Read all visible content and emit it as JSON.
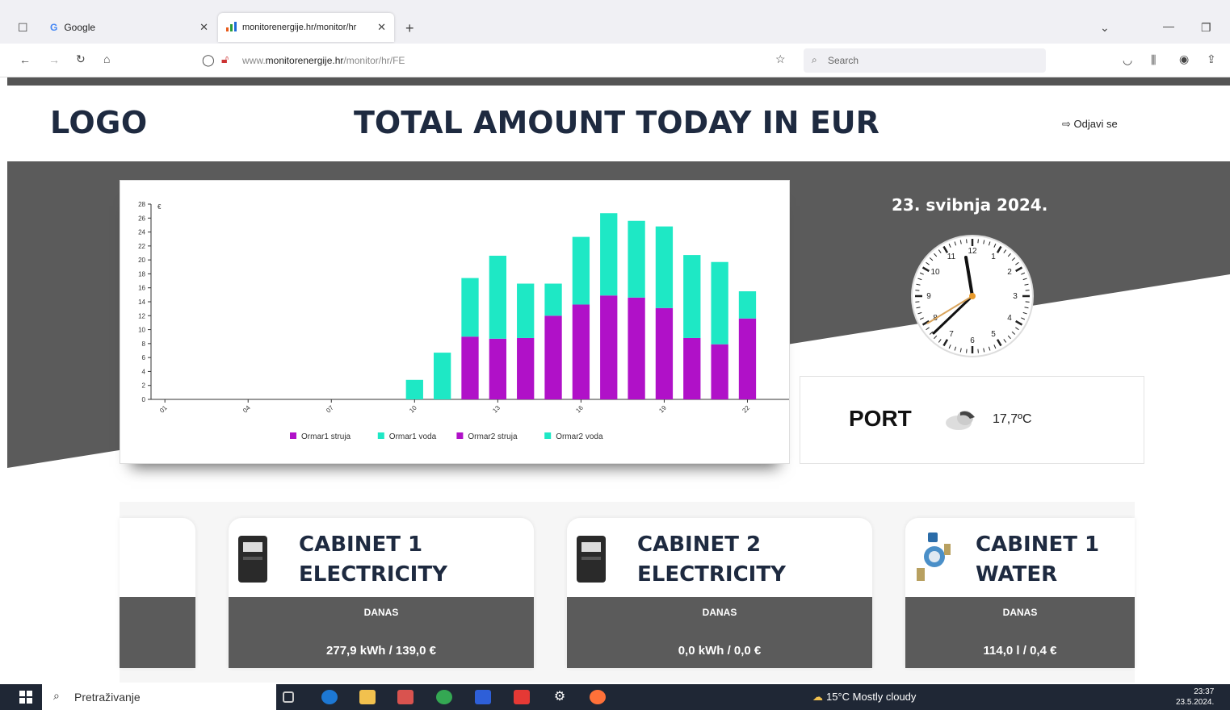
{
  "browser": {
    "tabs": [
      {
        "label": "Google",
        "icon": "google-g-icon"
      },
      {
        "label": "monitorenergije.hr/monitor/hr",
        "icon": "chart-bars-icon"
      }
    ],
    "url_prefix": "www.",
    "url_domain": "monitorenergije.hr",
    "url_path": "/monitor/hr/FE",
    "search_placeholder": "Search"
  },
  "header": {
    "logo": "LOGO",
    "title": "TOTAL AMOUNT TODAY IN EUR",
    "logout": "Odjavi se"
  },
  "side": {
    "date": "23. svibnja 2024.",
    "clock_time": "11:37",
    "port": "PORT",
    "temperature": "17,7ºC",
    "weather_icon": "cloudy-icon"
  },
  "colors": {
    "magenta": "#b011c8",
    "cyan": "#1ee8c5",
    "band": "#5b5b5b",
    "title": "#1e2a40"
  },
  "chart_data": {
    "type": "bar",
    "stacked": true,
    "ylim": [
      0,
      28
    ],
    "yticks": [
      0,
      2,
      4,
      6,
      8,
      10,
      12,
      14,
      16,
      18,
      20,
      22,
      24,
      26,
      28
    ],
    "ylabel": "€",
    "xlabel": "",
    "categories": [
      "01",
      "02",
      "03",
      "04",
      "05",
      "06",
      "07",
      "08",
      "09",
      "10",
      "11",
      "12",
      "13",
      "14",
      "15",
      "16",
      "17",
      "18",
      "19",
      "20",
      "21",
      "22",
      "23"
    ],
    "xtick_labels": {
      "01": "01",
      "04": "04",
      "07": "07",
      "10": "10",
      "13": "13",
      "16": "16",
      "19": "19",
      "22": "22"
    },
    "series": [
      {
        "name": "Ormar1 struja",
        "color": "#b011c8",
        "values": [
          0,
          0,
          0,
          0,
          0,
          0,
          0,
          0,
          0,
          0,
          0,
          9.0,
          8.7,
          8.8,
          12.0,
          13.6,
          14.9,
          14.6,
          13.1,
          8.8,
          7.9,
          11.6,
          0
        ]
      },
      {
        "name": "Ormar1 voda",
        "color": "#1ee8c5",
        "values": [
          0,
          0,
          0,
          0,
          0,
          0,
          0,
          0,
          0,
          2.8,
          6.7,
          8.4,
          11.9,
          7.8,
          4.6,
          9.7,
          11.8,
          11.0,
          11.7,
          11.9,
          11.8,
          3.9,
          0
        ]
      },
      {
        "name": "Ormar2 struja",
        "color": "#b011c8",
        "values": [
          0,
          0,
          0,
          0,
          0,
          0,
          0,
          0,
          0,
          0,
          0,
          0,
          0,
          0,
          0,
          0,
          0,
          0,
          0,
          0,
          0,
          0,
          0
        ]
      },
      {
        "name": "Ormar2 voda",
        "color": "#1ee8c5",
        "values": [
          0,
          0,
          0,
          0,
          0,
          0,
          0,
          0,
          0,
          0,
          0,
          0,
          0,
          0,
          0,
          0,
          0,
          0,
          0,
          0,
          0,
          0,
          0
        ]
      }
    ],
    "legend_position": "bottom"
  },
  "cabinets": [
    {
      "title_line1": "CABINET 1",
      "title_line2": "ELECTRICITY",
      "period": "DANAS",
      "value": "277,9 kWh / 139,0 €",
      "icon": "electric-meter-icon"
    },
    {
      "title_line1": "CABINET 2",
      "title_line2": "ELECTRICITY",
      "period": "DANAS",
      "value": "0,0 kWh / 0,0 €",
      "icon": "electric-meter-icon"
    },
    {
      "title_line1": "CABINET 1",
      "title_line2": "WATER",
      "period": "DANAS",
      "value": "114,0 l / 0,4 €",
      "icon": "water-meter-icon"
    }
  ],
  "taskbar": {
    "search": "Pretraživanje",
    "weather": "15°C  Mostly cloudy",
    "time": "23:37",
    "date": "23.5.2024."
  }
}
